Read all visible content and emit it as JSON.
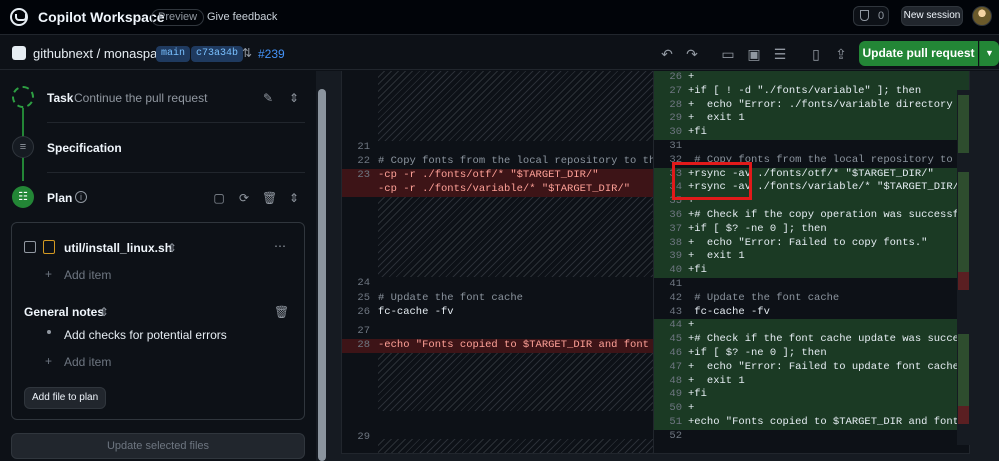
{
  "header": {
    "title": "Copilot Workspace",
    "preview_badge": "Preview",
    "feedback_link": "Give feedback",
    "count": "0",
    "new_session": "New session"
  },
  "repobar": {
    "repo": "githubnext / monaspace",
    "branch": "main",
    "commit": "c73a34b",
    "pr": "#239",
    "update_pr": "Update pull request"
  },
  "steps": {
    "task": {
      "title": "Task",
      "subtitle": "Continue the pull request"
    },
    "spec": {
      "title": "Specification"
    },
    "plan": {
      "title": "Plan"
    }
  },
  "plan": {
    "file": "util/install_linux.sh",
    "add_item": "Add item",
    "general_notes_title": "General notes",
    "note": "Add checks for potential errors",
    "add_item_2": "Add item",
    "add_file": "Add file to plan",
    "update_files": "Update selected files"
  },
  "diff_left": [
    {
      "n": "21",
      "code": "",
      "cls": ""
    },
    {
      "n": "22",
      "code": "# Copy fonts from the local repository to th",
      "cls": "cmt"
    },
    {
      "n": "23",
      "code": "-cp -r ./fonts/otf/* \"$TARGET_DIR/\"",
      "cls": "del"
    },
    {
      "n": "",
      "code": "-cp -r ./fonts/variable/* \"$TARGET_DIR/\"",
      "cls": "del"
    },
    {
      "n": "24",
      "code": "",
      "cls": ""
    },
    {
      "n": "25",
      "code": "# Update the font cache",
      "cls": "cmt"
    },
    {
      "n": "26",
      "code": "fc-cache -fv",
      "cls": ""
    },
    {
      "n": "27",
      "code": "",
      "cls": ""
    },
    {
      "n": "28",
      "code": "-echo \"Fonts copied to $TARGET_DIR and font c",
      "cls": "del"
    },
    {
      "n": "29",
      "code": "",
      "cls": ""
    }
  ],
  "diff_right": [
    {
      "n": "26",
      "code": "+",
      "cls": "add"
    },
    {
      "n": "27",
      "code": "+if [ ! -d \"./fonts/variable\" ]; then",
      "cls": "add"
    },
    {
      "n": "28",
      "code": "+  echo \"Error: ./fonts/variable directory do",
      "cls": "add"
    },
    {
      "n": "29",
      "code": "+  exit 1",
      "cls": "add"
    },
    {
      "n": "30",
      "code": "+fi",
      "cls": "add"
    },
    {
      "n": "31",
      "code": "",
      "cls": ""
    },
    {
      "n": "32",
      "code": " # Copy fonts from the local repository to th",
      "cls": "cmt"
    },
    {
      "n": "33",
      "code": "+rsync -av ./fonts/otf/* \"$TARGET_DIR/\"",
      "cls": "add"
    },
    {
      "n": "34",
      "code": "+rsync -av ./fonts/variable/* \"$TARGET_DIR/\"",
      "cls": "add"
    },
    {
      "n": "35",
      "code": "+",
      "cls": "add"
    },
    {
      "n": "36",
      "code": "+# Check if the copy operation was successful",
      "cls": "add"
    },
    {
      "n": "37",
      "code": "+if [ $? -ne 0 ]; then",
      "cls": "add"
    },
    {
      "n": "38",
      "code": "+  echo \"Error: Failed to copy fonts.\"",
      "cls": "add"
    },
    {
      "n": "39",
      "code": "+  exit 1",
      "cls": "add"
    },
    {
      "n": "40",
      "code": "+fi",
      "cls": "add"
    },
    {
      "n": "41",
      "code": "",
      "cls": ""
    },
    {
      "n": "42",
      "code": " # Update the font cache",
      "cls": "cmt"
    },
    {
      "n": "43",
      "code": " fc-cache -fv",
      "cls": ""
    },
    {
      "n": "44",
      "code": "+",
      "cls": "add"
    },
    {
      "n": "45",
      "code": "+# Check if the font cache update was succes",
      "cls": "add"
    },
    {
      "n": "46",
      "code": "+if [ $? -ne 0 ]; then",
      "cls": "add"
    },
    {
      "n": "47",
      "code": "+  echo \"Error: Failed to update font cache.\"",
      "cls": "add"
    },
    {
      "n": "48",
      "code": "+  exit 1",
      "cls": "add"
    },
    {
      "n": "49",
      "code": "+fi",
      "cls": "add"
    },
    {
      "n": "50",
      "code": "+",
      "cls": "add"
    },
    {
      "n": "51",
      "code": "+echo \"Fonts copied to $TARGET_DIR and font c",
      "cls": "add"
    },
    {
      "n": "52",
      "code": "",
      "cls": ""
    }
  ],
  "colors": {
    "accent": "#238636",
    "deleted": "#3d1417",
    "added": "#1b3a24",
    "highlight": "#e11a1a"
  }
}
